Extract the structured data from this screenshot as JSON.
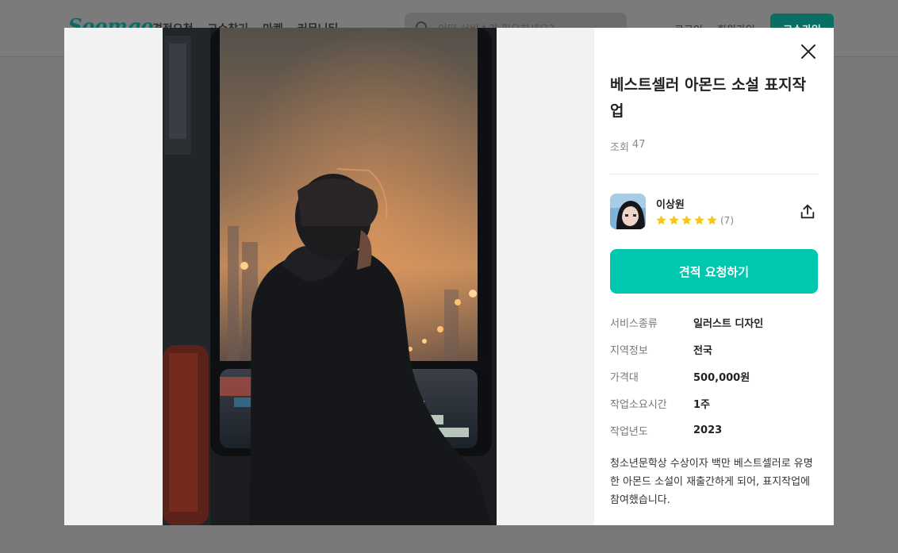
{
  "background_page": {
    "logo": "Soomgo",
    "nav": [
      "견적요청",
      "고수찾기",
      "마켓",
      "커뮤니티"
    ],
    "search_placeholder": "어떤 서비스가 필요하세요?",
    "login": "로그인",
    "signup": "회원가입",
    "cta": "고수가입"
  },
  "modal": {
    "title": "베스트셀러 아몬드 소설 표지작업",
    "views_label": "조회",
    "views_count": "47",
    "seller": {
      "name": "이상원",
      "rating_stars": 5,
      "review_count": "(7)"
    },
    "quote_button": "견적 요청하기",
    "info": [
      {
        "key": "서비스종류",
        "value": "일러스트 디자인"
      },
      {
        "key": "지역정보",
        "value": "전국"
      },
      {
        "key": "가격대",
        "value": "500,000원"
      },
      {
        "key": "작업소요시간",
        "value": "1주"
      },
      {
        "key": "작업년도",
        "value": "2023"
      }
    ],
    "description": "청소년문학상 수상이자 백만 베스트셀러로 유명한 아몬드 소설이 재출간하게 되어, 표지작업에 참여했습니다."
  },
  "colors": {
    "accent": "#00c7ae",
    "star": "#f5c518",
    "overlay": "#787878"
  },
  "icons": [
    "search-icon",
    "close-icon",
    "star-icon",
    "share-icon"
  ]
}
